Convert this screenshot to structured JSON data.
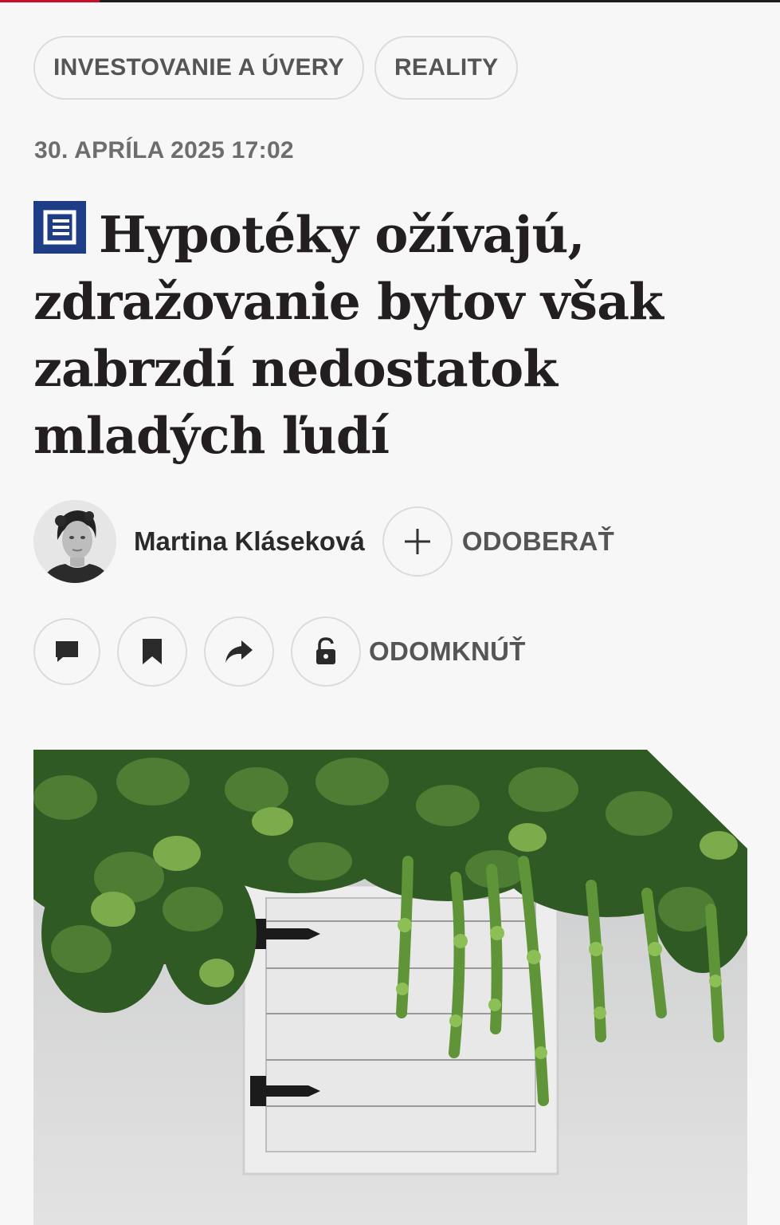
{
  "tags": [
    "INVESTOVANIE A ÚVERY",
    "REALITY"
  ],
  "date": "30. APRÍLA 2025 17:02",
  "headline": "Hypotéky ožívajú, zdražovanie bytov však zabrzdí nedostatok mladých ľudí",
  "author": {
    "name": "Martina Kláseková",
    "follow_label": "ODOBERAŤ"
  },
  "actions": {
    "comment_icon": "comment-icon",
    "bookmark_icon": "bookmark-icon",
    "share_icon": "share-icon",
    "lock_icon": "unlock-icon",
    "unlock_label": "ODOMKNÚŤ"
  },
  "colors": {
    "brand_red": "#c8102e",
    "brand_blue": "#1f3d86",
    "background": "#f8f7f7"
  }
}
